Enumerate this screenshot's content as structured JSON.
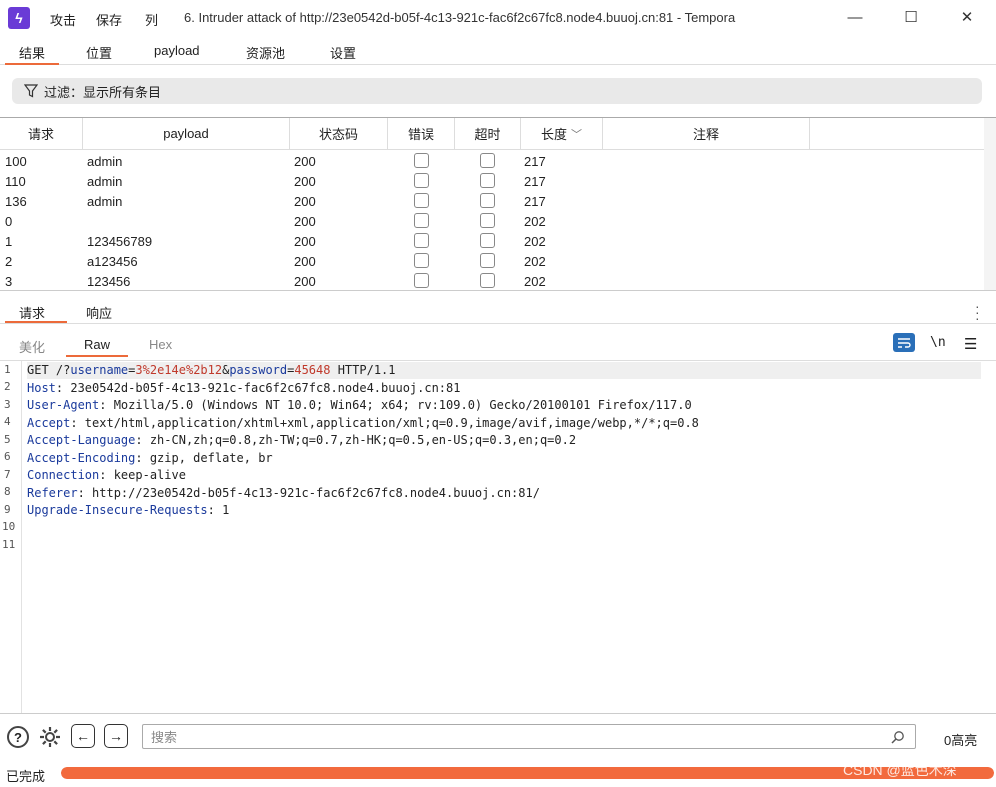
{
  "titlebar": {
    "menu_attack": "攻击",
    "menu_save": "保存",
    "menu_columns": "列",
    "window_title": "6. Intruder attack of http://23e0542d-b05f-4c13-921c-fac6f2c67fc8.node4.buuoj.cn:81 - Tempora",
    "minimize": "—",
    "maximize": "☐",
    "close": "✕"
  },
  "tabs": [
    "结果",
    "位置",
    "payload",
    "资源池",
    "设置"
  ],
  "filter": {
    "label": "过滤：显示所有条目"
  },
  "table": {
    "headers": [
      "请求",
      "payload",
      "状态码",
      "错误",
      "超时",
      "长度",
      "注释"
    ],
    "sort_indicator": "﹀",
    "rows": [
      {
        "req": "100",
        "payload": "admin",
        "status": "200",
        "len": "217"
      },
      {
        "req": "110",
        "payload": "admin",
        "status": "200",
        "len": "217"
      },
      {
        "req": "136",
        "payload": "admin",
        "status": "200",
        "len": "217"
      },
      {
        "req": "0",
        "payload": "",
        "status": "200",
        "len": "202"
      },
      {
        "req": "1",
        "payload": "123456789",
        "status": "200",
        "len": "202"
      },
      {
        "req": "2",
        "payload": "a123456",
        "status": "200",
        "len": "202"
      },
      {
        "req": "3",
        "payload": "123456",
        "status": "200",
        "len": "202"
      }
    ]
  },
  "lower_tabs": {
    "request": "请求",
    "response": "响应"
  },
  "sub_tabs": {
    "pretty": "美化",
    "raw": "Raw",
    "hex": "Hex"
  },
  "toolbar": {
    "newline": "\\n",
    "menu": "☰"
  },
  "editor": {
    "line_numbers": [
      "1",
      "2",
      "3",
      "4",
      "5",
      "6",
      "7",
      "8",
      "9",
      "10",
      "11"
    ],
    "line1": {
      "method": "GET /?",
      "p1": "username",
      "eq1": "=",
      "v1": "3%2e14e%2b12",
      "amp": "&",
      "p2": "password",
      "eq2": "=",
      "v2": "45648",
      "tail": " HTTP/1.1"
    },
    "headers": [
      {
        "k": "Host",
        "v": ": 23e0542d-b05f-4c13-921c-fac6f2c67fc8.node4.buuoj.cn:81"
      },
      {
        "k": "User-Agent",
        "v": ": Mozilla/5.0 (Windows NT 10.0; Win64; x64; rv:109.0) Gecko/20100101 Firefox/117.0"
      },
      {
        "k": "Accept",
        "v": ": text/html,application/xhtml+xml,application/xml;q=0.9,image/avif,image/webp,*/*;q=0.8"
      },
      {
        "k": "Accept-Language",
        "v": ": zh-CN,zh;q=0.8,zh-TW;q=0.7,zh-HK;q=0.5,en-US;q=0.3,en;q=0.2"
      },
      {
        "k": "Accept-Encoding",
        "v": ": gzip, deflate, br"
      },
      {
        "k": "Connection",
        "v": ": keep-alive"
      },
      {
        "k": "Referer",
        "v": ": http://23e0542d-b05f-4c13-921c-fac6f2c67fc8.node4.buuoj.cn:81/"
      },
      {
        "k": "Upgrade-Insecure-Requests",
        "v": ": 1"
      }
    ]
  },
  "bottombar": {
    "search_placeholder": "搜索",
    "highlight_count": "0高亮",
    "help": "?",
    "back": "←",
    "forward": "→"
  },
  "status": {
    "text": "已完成",
    "progress": 1.0,
    "watermark": "CSDN @蓝色木深"
  },
  "colors": {
    "accent": "#ec6a3a",
    "progress": "#f26a3d",
    "app_icon": "#6a3bd6"
  }
}
